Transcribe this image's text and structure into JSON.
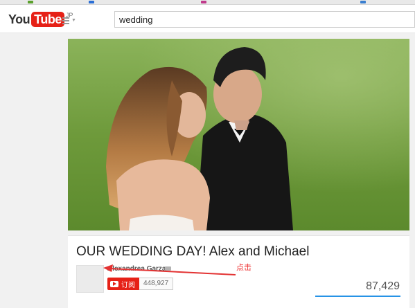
{
  "header": {
    "logo_prefix": "You",
    "logo_tube": "Tube",
    "logo_region": "JP",
    "search_value": "wedding"
  },
  "video": {
    "title": "OUR WEDDING DAY! Alex and Michael"
  },
  "channel": {
    "name": "Alexandrea Garza",
    "subscribe_label": "订阅",
    "subscriber_count": "448,927"
  },
  "stats": {
    "view_count": "87,429",
    "like_fraction": 1.0
  },
  "annotation": {
    "text": "点击",
    "color": "#e33333"
  },
  "colors": {
    "brand_red": "#e62117",
    "like_blue": "#2793e6"
  },
  "icons": [
    "guide-menu-icon",
    "verified-icon",
    "play-icon"
  ]
}
